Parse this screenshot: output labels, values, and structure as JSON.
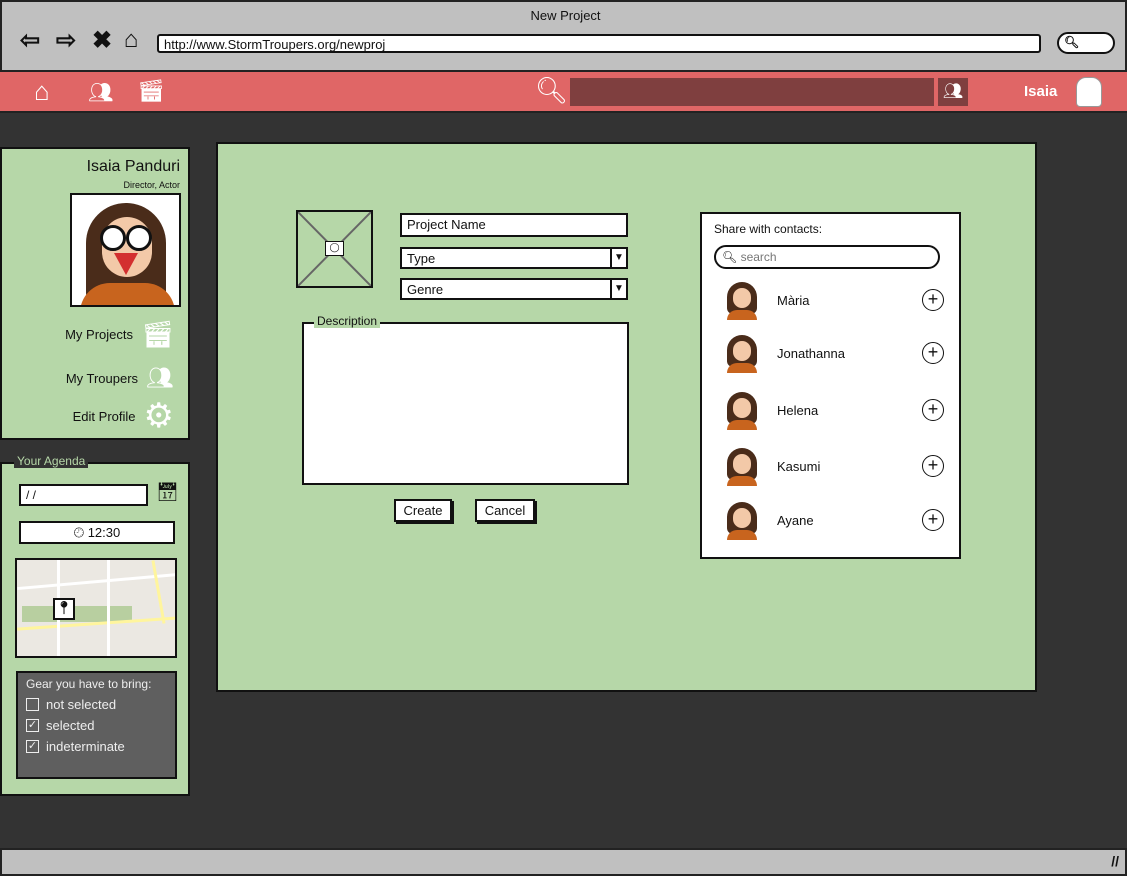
{
  "window": {
    "title": "New Project",
    "url": "http://www.StormTroupers.org/newproj"
  },
  "topbar": {
    "user_name": "Isaia"
  },
  "profile": {
    "name": "Isaia Panduri",
    "roles": "Director,  Actor",
    "menu": [
      {
        "label": "My Projects",
        "icon": "clapperboard-icon"
      },
      {
        "label": "My Troupers",
        "icon": "users-icon"
      },
      {
        "label": "Edit Profile",
        "icon": "gear-icon"
      }
    ]
  },
  "agenda": {
    "title": "Your Agenda",
    "date_value": " /  /",
    "time_value": "12:30",
    "gear_title": "Gear you have to bring:",
    "gear": [
      {
        "label": "not selected",
        "checked": false
      },
      {
        "label": "selected",
        "checked": true
      },
      {
        "label": "indeterminate",
        "checked": true
      }
    ]
  },
  "form": {
    "name_placeholder": "Project Name",
    "type_value": "Type",
    "genre_value": "Genre",
    "description_label": "Description",
    "create_label": "Create",
    "cancel_label": "Cancel"
  },
  "share": {
    "title": "Share with contacts:",
    "search_placeholder": "search",
    "contacts": [
      "Mària",
      "Jonathanna",
      "Helena",
      "Kasumi",
      "Ayane"
    ]
  },
  "colors": {
    "topbar": "#e06666",
    "panel": "#b6d7a8",
    "background": "#333333"
  }
}
